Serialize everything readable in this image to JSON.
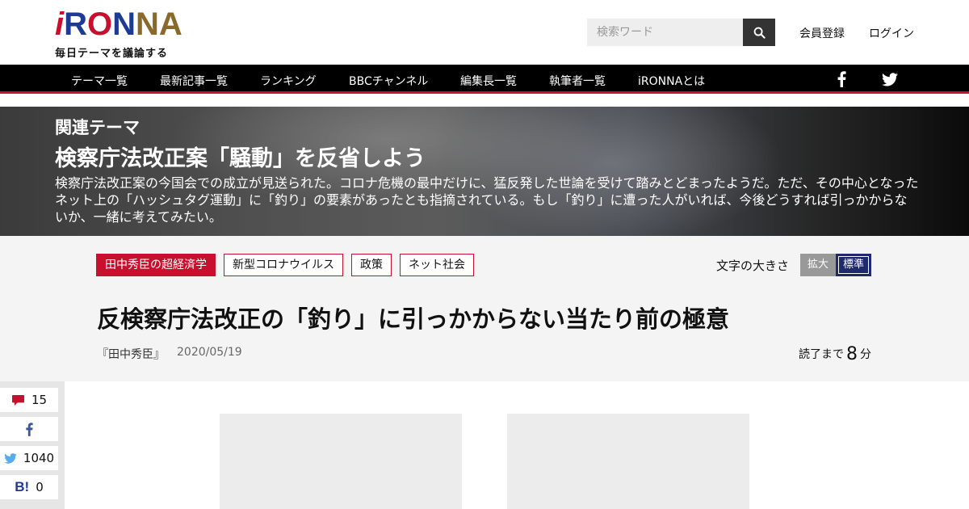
{
  "header": {
    "logo_letters": [
      "i",
      "R",
      "O",
      "N",
      "N",
      "A"
    ],
    "tagline": "毎日テーマを議論する",
    "search_placeholder": "検索ワード",
    "register_label": "会員登録",
    "login_label": "ログイン"
  },
  "nav": {
    "items": [
      "テーマ一覧",
      "最新記事一覧",
      "ランキング",
      "BBCチャンネル",
      "編集長一覧",
      "執筆者一覧",
      "iRONNAとは"
    ],
    "social_icons": [
      "facebook-icon",
      "twitter-icon"
    ]
  },
  "hero": {
    "kicker": "関連テーマ",
    "title": "検察庁法改正案「騒動」を反省しよう",
    "description": "検察庁法改正案の今国会での成立が見送られた。コロナ危機の最中だけに、猛反発した世論を受けて踏みとどまったようだ。ただ、その中心となったネット上の「ハッシュタグ運動」に「釣り」の要素があったとも指摘されている。もし「釣り」に遭った人がいれば、今後どうすれば引っかからないか、一緒に考えてみたい。"
  },
  "tags": [
    "田中秀臣の超経済学",
    "新型コロナウイルス",
    "政策",
    "ネット社会"
  ],
  "font_size": {
    "label": "文字の大きさ",
    "enlarge": "拡大",
    "standard": "標準"
  },
  "article": {
    "title": "反検察庁法改正の「釣り」に引っかからない当たり前の極意",
    "author": "『田中秀臣』",
    "date": "2020/05/19",
    "read_prefix": "読了まで",
    "read_minutes": "8",
    "read_suffix": "分"
  },
  "share": {
    "comments": "15",
    "twitter": "1040",
    "hatena": "0"
  },
  "colors": {
    "accent_red": "#c8102e",
    "brand_blue": "#1f3a93",
    "brand_gold": "#8a6a2a"
  }
}
